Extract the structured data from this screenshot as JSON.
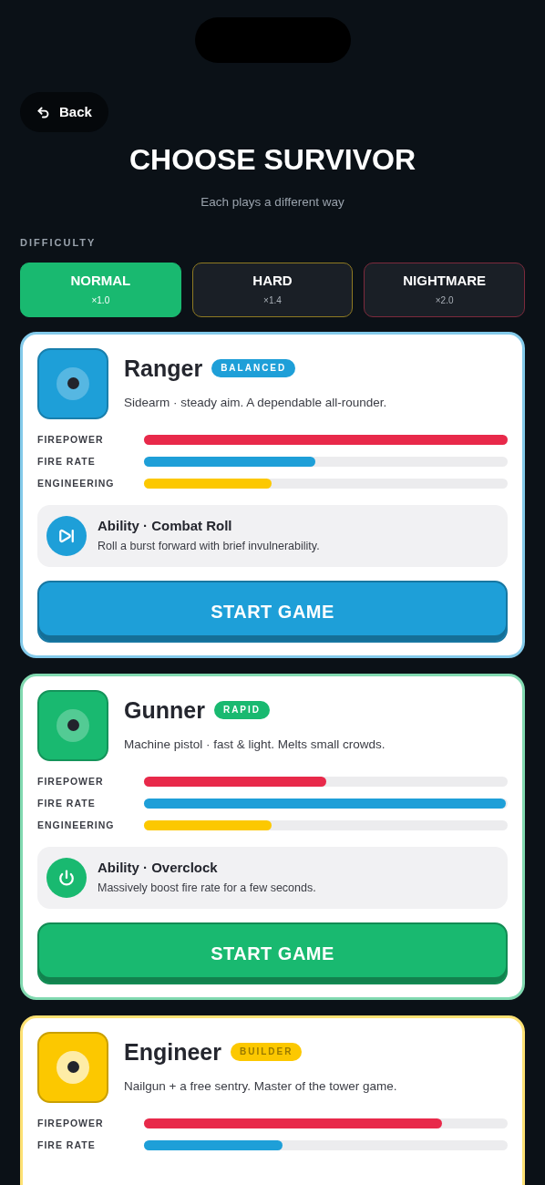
{
  "back": {
    "label": "Back"
  },
  "title": "CHOOSE SURVIVOR",
  "subtitle": "Each plays a different way",
  "difficulty": {
    "label": "DIFFICULTY",
    "options": [
      {
        "name": "NORMAL",
        "multiplier": "×1.0",
        "selected": true,
        "color": "#19b970"
      },
      {
        "name": "HARD",
        "multiplier": "×1.4",
        "selected": false,
        "color": "#8f7a22"
      },
      {
        "name": "NIGHTMARE",
        "multiplier": "×2.0",
        "selected": false,
        "color": "#7d2a3c"
      }
    ]
  },
  "characters": [
    {
      "name": "Ranger",
      "tag": "BALANCED",
      "color": "#1e9fd8",
      "description": "Sidearm · steady aim. A dependable all-rounder.",
      "stats": [
        {
          "label": "FIREPOWER",
          "level": 1.0
        },
        {
          "label": "FIRE RATE",
          "level": 0.47
        },
        {
          "label": "ENGINEERING",
          "level": 0.35
        }
      ],
      "ability": {
        "title": "Ability · Combat Roll",
        "text": "Roll a burst forward with brief invulnerability."
      },
      "button": "START GAME"
    },
    {
      "name": "Gunner",
      "tag": "RAPID",
      "color": "#19b970",
      "description": "Machine pistol · fast & light. Melts small crowds.",
      "stats": [
        {
          "label": "FIREPOWER",
          "level": 0.5
        },
        {
          "label": "FIRE RATE",
          "level": 0.995
        },
        {
          "label": "ENGINEERING",
          "level": 0.35
        }
      ],
      "ability": {
        "title": "Ability · Overclock",
        "text": "Massively boost fire rate for a few seconds."
      },
      "button": "START GAME"
    },
    {
      "name": "Engineer",
      "tag": "BUILDER",
      "color": "#fcc800",
      "description": "Nailgun + a free sentry. Master of the tower game.",
      "stats": [
        {
          "label": "FIREPOWER",
          "level": 0.82
        },
        {
          "label": "FIRE RATE",
          "level": 0.38
        }
      ]
    }
  ]
}
